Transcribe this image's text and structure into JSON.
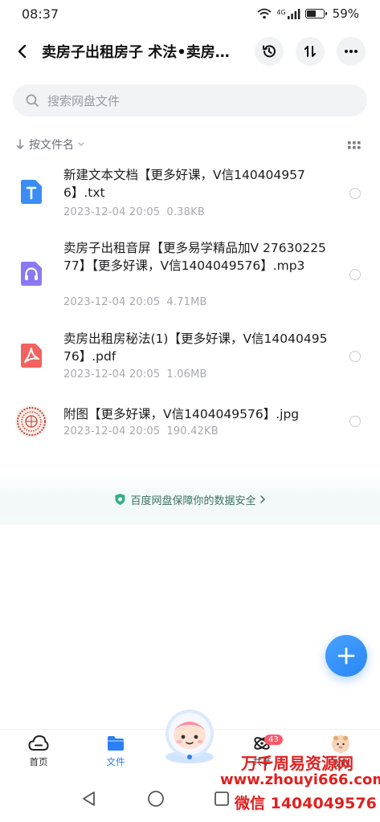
{
  "status_bar": {
    "time": "08:37",
    "battery": "59%",
    "battery_level": 0.59,
    "network": "4G"
  },
  "header": {
    "title": "卖房子出租房子 术法•卖房子出租房子技巧"
  },
  "search": {
    "placeholder": "搜索网盘文件"
  },
  "sort": {
    "label": "按文件名"
  },
  "files": [
    {
      "name": "新建文本文档【更多好课，V信1404049576】.txt",
      "date": "2023-12-04  20:05",
      "size": "0.38KB",
      "type": "txt",
      "color": "#3b8df5"
    },
    {
      "name": "卖房子出租音屏【更多易学精品加V 2763022577】【更多好课，V信1404049576】.mp3",
      "date": "2023-12-04  20:05",
      "size": "4.71MB",
      "type": "audio",
      "color": "#8a79f3"
    },
    {
      "name": "卖房出租房秘法(1)【更多好课，V信1404049576】.pdf",
      "date": "2023-12-04  20:05",
      "size": "1.06MB",
      "type": "pdf",
      "color": "#f2625f"
    },
    {
      "name": "附图【更多好课，V信1404049576】.jpg",
      "date": "2023-12-04  20:05",
      "size": "190.42KB",
      "type": "image",
      "color": "#c2403b"
    }
  ],
  "safety": {
    "text": "百度网盘保障你的数据安全"
  },
  "nav": {
    "home": "首页",
    "files": "文件",
    "share": "共享",
    "share_badge": "43",
    "mine": "我的"
  },
  "watermark": {
    "line1": "万千周易资源网",
    "line2": "www.zhouyi666.com",
    "line3": "微信 1404049576"
  },
  "colors": {
    "accent": "#2b7ff4",
    "watermark": "#e02020"
  }
}
